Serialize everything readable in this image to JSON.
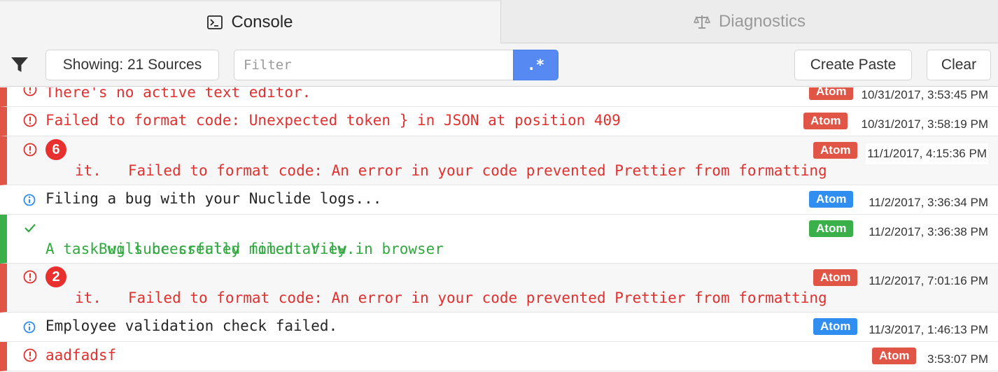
{
  "tabs": [
    {
      "label": "Console",
      "icon": "terminal-icon",
      "active": true
    },
    {
      "label": "Diagnostics",
      "icon": "scales-icon",
      "active": false
    }
  ],
  "toolbar": {
    "sources_label": "Showing: 21 Sources",
    "filter_placeholder": "Filter",
    "regex_label": ".*",
    "create_paste_label": "Create Paste",
    "clear_label": "Clear"
  },
  "colors": {
    "error": "#e0302f",
    "success": "#32a940",
    "info_icon": "#2f8ef0",
    "regex_button": "#568af2"
  },
  "records": [
    {
      "level": "error",
      "icon": "alert-circle-icon",
      "count": "",
      "lines": [
        "There's no active text editor."
      ],
      "source": "Atom",
      "timestamp": "10/31/2017, 3:53:45 PM"
    },
    {
      "level": "error",
      "icon": "alert-circle-icon",
      "count": "",
      "lines": [
        "Failed to format code: Unexpected token } in JSON at position 409"
      ],
      "source": "Atom",
      "timestamp": "10/31/2017, 3:58:19 PM"
    },
    {
      "level": "error",
      "icon": "alert-circle-icon",
      "count": "6",
      "lines": [
        "Failed to format code: An error in your code prevented Prettier from formatting",
        "it."
      ],
      "source": "Atom",
      "timestamp": "11/1/2017, 4:15:36 PM"
    },
    {
      "level": "info",
      "icon": "info-circle-icon",
      "count": "",
      "lines": [
        "Filing a bug with your Nuclide logs..."
      ],
      "source": "Atom",
      "timestamp": "11/2/2017, 3:36:34 PM"
    },
    {
      "level": "success",
      "icon": "check-icon",
      "count": "",
      "lines": [
        "Bug successfully filed. View in browser",
        "A task will be created momentarily."
      ],
      "source": "Atom",
      "timestamp": "11/2/2017, 3:36:38 PM"
    },
    {
      "level": "error",
      "icon": "alert-circle-icon",
      "count": "2",
      "lines": [
        "Failed to format code: An error in your code prevented Prettier from formatting",
        "it."
      ],
      "source": "Atom",
      "timestamp": "11/2/2017, 7:01:16 PM"
    },
    {
      "level": "info",
      "icon": "info-circle-icon",
      "count": "",
      "lines": [
        "Employee validation check failed."
      ],
      "source": "Atom",
      "timestamp": "11/3/2017, 1:46:13 PM"
    },
    {
      "level": "error",
      "icon": "alert-circle-icon",
      "count": "",
      "lines": [
        "aadfadsf"
      ],
      "source": "Atom",
      "timestamp": "3:53:07 PM"
    }
  ]
}
